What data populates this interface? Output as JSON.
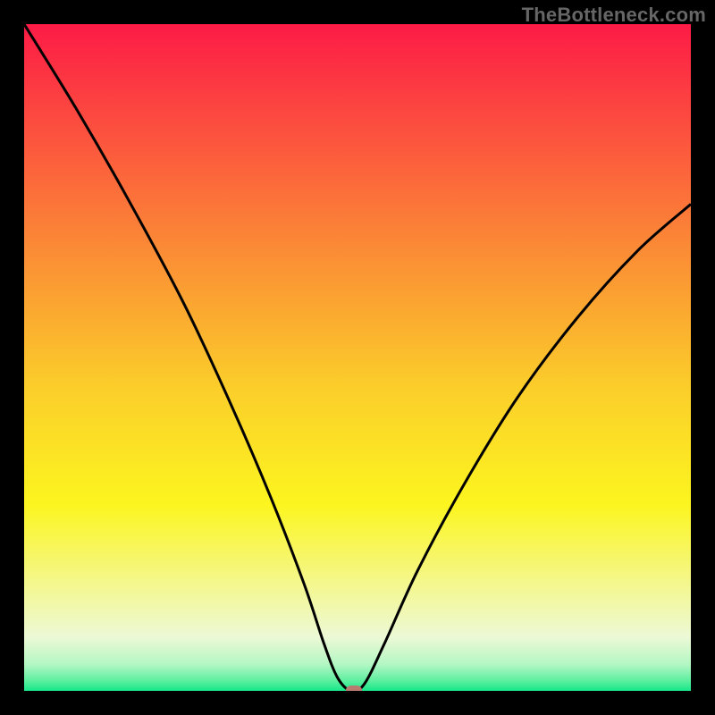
{
  "watermark": "TheBottleneck.com",
  "colors": {
    "frame_bg": "#000000",
    "curve_stroke": "#000000",
    "marker_fill": "#b97a6f",
    "gradient_stops": [
      {
        "pct": 0,
        "color": "#fd1b46"
      },
      {
        "pct": 15,
        "color": "#fc4d3f"
      },
      {
        "pct": 35,
        "color": "#fb8f35"
      },
      {
        "pct": 55,
        "color": "#fbcf2a"
      },
      {
        "pct": 72,
        "color": "#fcf51f"
      },
      {
        "pct": 84,
        "color": "#f4f78e"
      },
      {
        "pct": 92,
        "color": "#ecf9d6"
      },
      {
        "pct": 96,
        "color": "#b4f7c4"
      },
      {
        "pct": 98.5,
        "color": "#5cefa0"
      },
      {
        "pct": 100,
        "color": "#17e789"
      }
    ]
  },
  "chart_data": {
    "type": "line",
    "title": "",
    "xlabel": "",
    "ylabel": "",
    "xlim": [
      0,
      100
    ],
    "ylim": [
      0,
      100
    ],
    "series": [
      {
        "name": "bottleneck-curve",
        "points": [
          {
            "x": 0,
            "y": 100
          },
          {
            "x": 8,
            "y": 87
          },
          {
            "x": 16,
            "y": 73
          },
          {
            "x": 24,
            "y": 58
          },
          {
            "x": 31,
            "y": 43
          },
          {
            "x": 37,
            "y": 29
          },
          {
            "x": 42,
            "y": 16
          },
          {
            "x": 45,
            "y": 7
          },
          {
            "x": 47,
            "y": 2
          },
          {
            "x": 49,
            "y": 0
          },
          {
            "x": 51,
            "y": 1
          },
          {
            "x": 54,
            "y": 7
          },
          {
            "x": 59,
            "y": 18
          },
          {
            "x": 66,
            "y": 31
          },
          {
            "x": 74,
            "y": 44
          },
          {
            "x": 83,
            "y": 56
          },
          {
            "x": 92,
            "y": 66
          },
          {
            "x": 100,
            "y": 73
          }
        ]
      }
    ],
    "marker": {
      "x": 49.5,
      "y": 0
    }
  }
}
